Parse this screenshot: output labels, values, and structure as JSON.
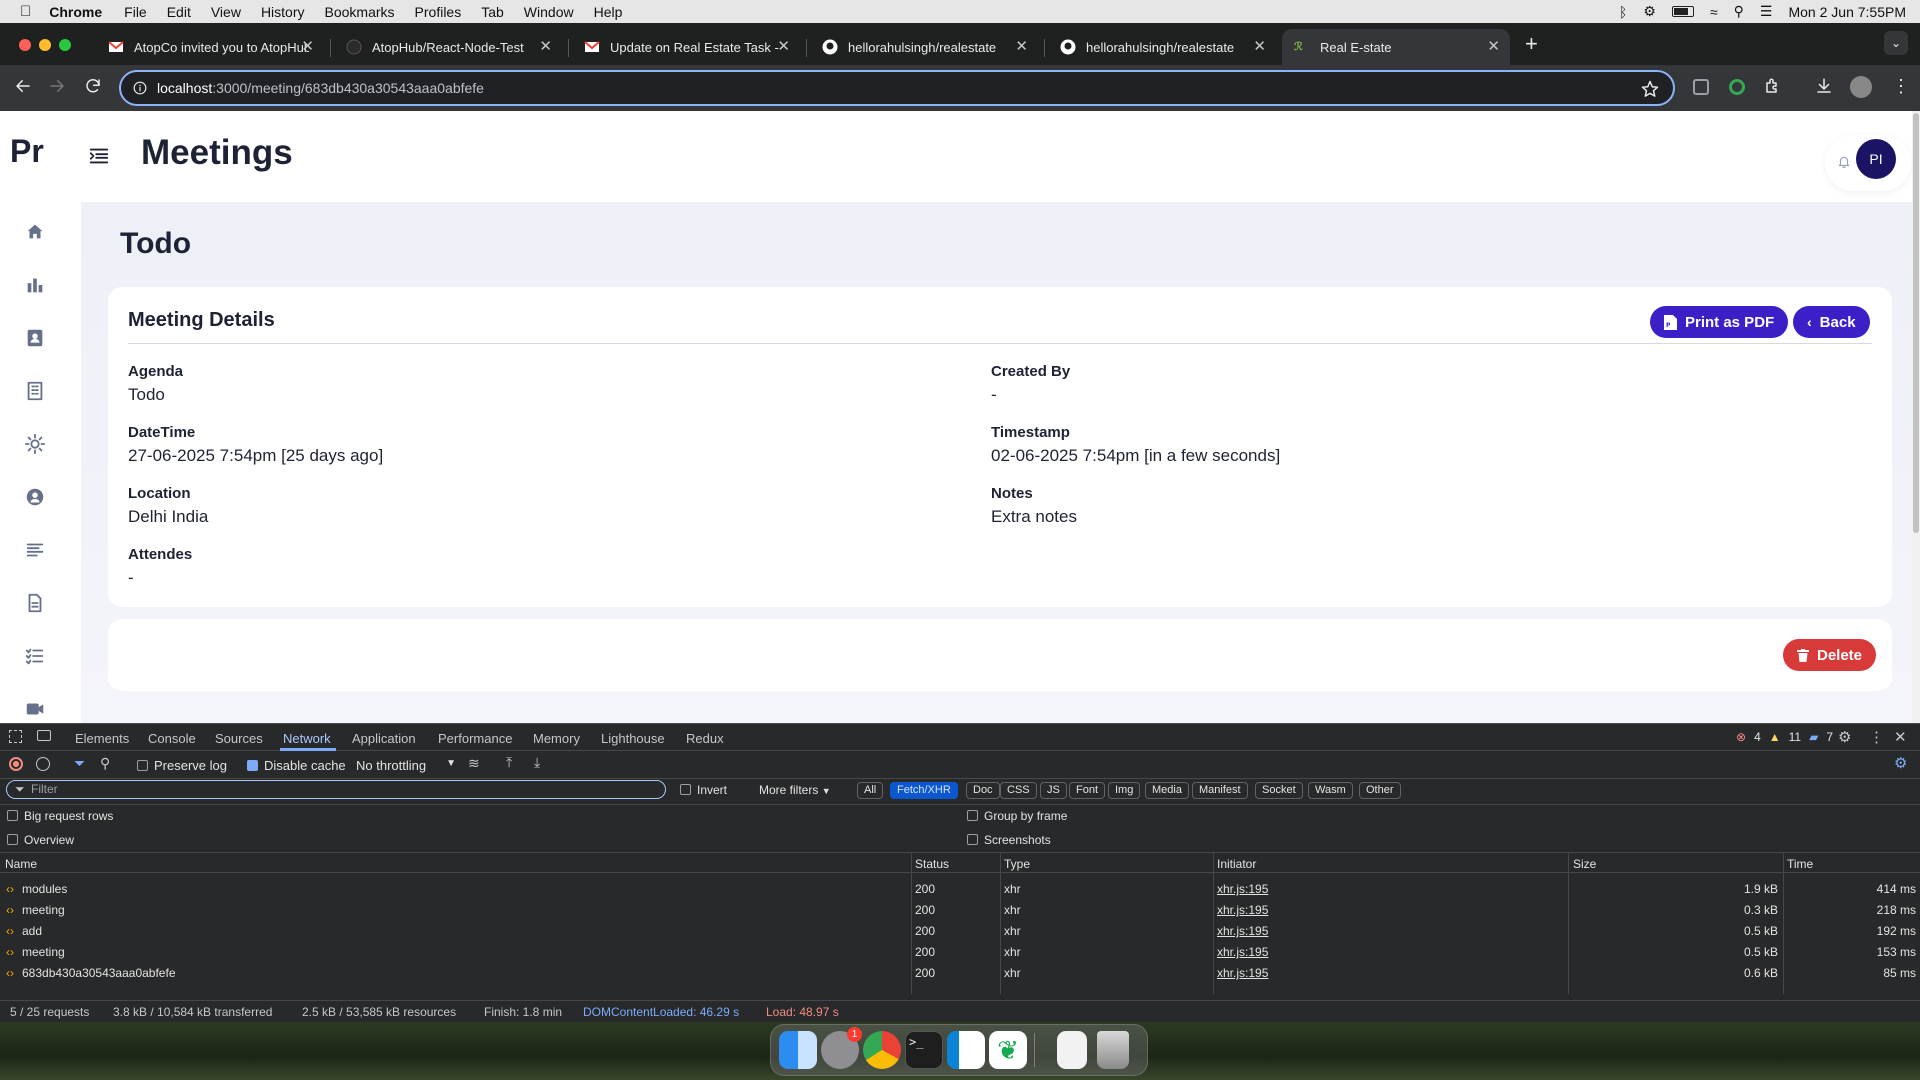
{
  "menubar": {
    "app": "Chrome",
    "items": [
      "File",
      "Edit",
      "View",
      "History",
      "Bookmarks",
      "Profiles",
      "Tab",
      "Window",
      "Help"
    ],
    "datetime": "Mon 2 Jun  7:55PM"
  },
  "browser": {
    "tabs": [
      {
        "title": "AtopCo invited you to AtopHub",
        "icon": "gmail-icon"
      },
      {
        "title": "AtopHub/React-Node-Test",
        "icon": "github-icon"
      },
      {
        "title": "Update on Real Estate Task -",
        "icon": "gmail-icon"
      },
      {
        "title": "hellorahulsingh/realestate",
        "icon": "github-icon"
      },
      {
        "title": "hellorahulsingh/realestate",
        "icon": "github-icon"
      },
      {
        "title": "Real E-state",
        "icon": "site-icon"
      }
    ],
    "url_host": "localhost",
    "url_path": ":3000/meeting/683db430a30543aaa0abfefe"
  },
  "app": {
    "logo": "Pr",
    "page_title": "Meetings",
    "avatar_initials": "PI",
    "heading": "Todo",
    "details_title": "Meeting Details",
    "print_label": "Print as PDF",
    "back_label": "Back",
    "delete_label": "Delete",
    "fields": {
      "agenda_label": "Agenda",
      "agenda_value": "Todo",
      "created_by_label": "Created By",
      "created_by_value": "-",
      "datetime_label": "DateTime",
      "datetime_value": "27-06-2025 7:54pm [25 days ago]",
      "timestamp_label": "Timestamp",
      "timestamp_value": "02-06-2025 7:54pm [in a few seconds]",
      "location_label": "Location",
      "location_value": "Delhi India",
      "notes_label": "Notes",
      "notes_value": "Extra notes",
      "attendes_label": "Attendes",
      "attendes_value": "-"
    },
    "sidebar_icons": [
      "home-icon",
      "bar-chart-icon",
      "contacts-icon",
      "building-icon",
      "lightbulb-icon",
      "user-circle-icon",
      "lines-icon",
      "document-icon",
      "checklist-icon",
      "video-icon"
    ]
  },
  "devtools": {
    "tabs": [
      "Elements",
      "Console",
      "Sources",
      "Network",
      "Application",
      "Performance",
      "Memory",
      "Lighthouse",
      "Redux"
    ],
    "active_tab": "Network",
    "errors": "4",
    "warnings": "11",
    "messages": "7",
    "preserve_log": "Preserve log",
    "disable_cache": "Disable cache",
    "throttling": "No throttling",
    "filter_placeholder": "Filter",
    "invert": "Invert",
    "more_filters": "More filters",
    "type_filters": [
      "All",
      "Fetch/XHR",
      "Doc",
      "CSS",
      "JS",
      "Font",
      "Img",
      "Media",
      "Manifest",
      "Socket",
      "Wasm",
      "Other"
    ],
    "active_filter": "Fetch/XHR",
    "options": {
      "big_rows": "Big request rows",
      "group_by_frame": "Group by frame",
      "overview": "Overview",
      "screenshots": "Screenshots"
    },
    "columns": {
      "name": "Name",
      "status": "Status",
      "type": "Type",
      "initiator": "Initiator",
      "size": "Size",
      "time": "Time"
    },
    "requests": [
      {
        "name": "modules",
        "status": "200",
        "type": "xhr",
        "initiator": "xhr.js:195",
        "size": "1.9 kB",
        "time": "414 ms"
      },
      {
        "name": "meeting",
        "status": "200",
        "type": "xhr",
        "initiator": "xhr.js:195",
        "size": "0.3 kB",
        "time": "218 ms"
      },
      {
        "name": "add",
        "status": "200",
        "type": "xhr",
        "initiator": "xhr.js:195",
        "size": "0.5 kB",
        "time": "192 ms"
      },
      {
        "name": "meeting",
        "status": "200",
        "type": "xhr",
        "initiator": "xhr.js:195",
        "size": "0.5 kB",
        "time": "153 ms"
      },
      {
        "name": "683db430a30543aaa0abfefe",
        "status": "200",
        "type": "xhr",
        "initiator": "xhr.js:195",
        "size": "0.6 kB",
        "time": "85 ms"
      }
    ],
    "summary": {
      "requests": "5 / 25 requests",
      "transferred": "3.8 kB / 10,584 kB transferred",
      "resources": "2.5 kB / 53,585 kB resources",
      "finish": "Finish: 1.8 min",
      "dcl": "DOMContentLoaded: 46.29 s",
      "load": "Load: 48.97 s"
    }
  },
  "dock": {
    "badge": "1"
  },
  "colors": {
    "accent": "#3d1fc7",
    "danger": "#d83a3a",
    "devtools_blue": "#7cacf8"
  }
}
